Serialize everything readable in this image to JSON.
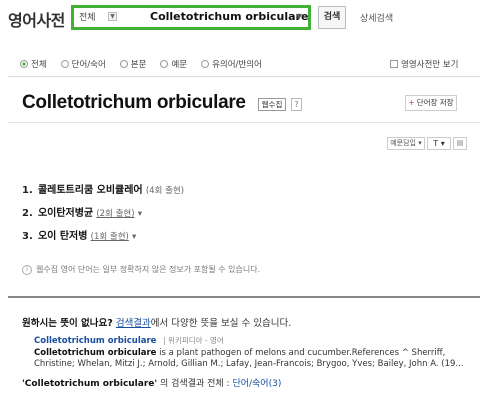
{
  "header": {
    "logo": "영어사전",
    "scope": "전체",
    "query": "Colletotrichum  orbiculare",
    "search_button": "검색",
    "detail_search": "상세검색"
  },
  "filters": {
    "options": [
      "전체",
      "단어/숙어",
      "본문",
      "예문",
      "유의어/반의어"
    ],
    "selected": "전체",
    "only_dict_label": "영영사전만 보기"
  },
  "entry": {
    "title": "Colletotrichum orbiculare",
    "badge": "웹수집",
    "help": "?",
    "save_label": "단어장 저장",
    "tools": {
      "example": "예문담입",
      "font": "T",
      "print": "▤"
    },
    "meanings": [
      {
        "num": "1.",
        "word": "콜레토트리쿰 오비큘레어",
        "count": "(4회 출현)"
      },
      {
        "num": "2.",
        "word": "오이탄저병균",
        "count": "(2회 출현)"
      },
      {
        "num": "3.",
        "word": "오이 탄저병",
        "count": "(1회 출현)"
      }
    ],
    "notice": "웹수집 영어 단어는 일부 정확하지 않은 정보가 포함될 수 있습니다."
  },
  "web": {
    "question_prefix": "원하시는 뜻이 없나요?",
    "question_link": "검색결과",
    "question_suffix": "에서 다양한 뜻을 보실 수 있습니다.",
    "result_title": "Colletotrichum orbiculare",
    "result_source": "| 위키피디아 - 영어",
    "snippet_bold": "Colletotrichum orbiculare",
    "snippet_rest": " is a plant pathogen of melons and cucumber.References ^ Sherriff, Christine; Whelan, Mitzi J.; Arnold, Gillian M.; Lafay, Jean-Francois; Brygoo, Yves; Bailey, John A. (19...",
    "summary_query": "'Colletotrichum orbiculare'",
    "summary_mid": " 의 검색결과 전체 : ",
    "summary_link": "단어/숙어(3)"
  }
}
